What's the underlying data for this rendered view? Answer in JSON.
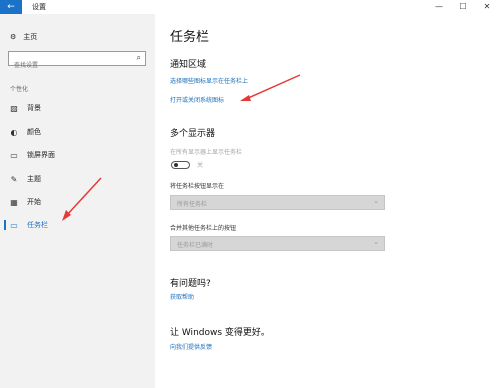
{
  "window": {
    "title": "设置",
    "back_icon": "←",
    "minimize_icon": "—",
    "maximize_icon": "☐",
    "close_icon": "✕"
  },
  "sidebar": {
    "home_icon": "⚙",
    "home_label": "主页",
    "search_placeholder": "查找设置",
    "search_icon": "⌕",
    "section_label": "个性化",
    "items": [
      {
        "label": "背景",
        "icon": "▨"
      },
      {
        "label": "颜色",
        "icon": "◐"
      },
      {
        "label": "锁屏界面",
        "icon": "▭"
      },
      {
        "label": "主题",
        "icon": "✎"
      },
      {
        "label": "开始",
        "icon": "▦"
      },
      {
        "label": "任务栏",
        "icon": "▭"
      }
    ],
    "active_item": "任务栏"
  },
  "main": {
    "title": "任务栏",
    "notification": {
      "title": "通知区域",
      "link1": "选择哪些图标显示在任务栏上",
      "link2": "打开或关闭系统图标"
    },
    "multi_display": {
      "title": "多个显示器",
      "show_all_label": "在所有显示器上显示任务栏",
      "toggle_state": "关",
      "buttons_label": "将任务栏按钮显示在",
      "buttons_value": "所有任务栏",
      "combine_label": "合并其他任务栏上的按钮",
      "combine_value": "任务栏已满时"
    },
    "questions": {
      "title": "有问题吗?",
      "link": "获取帮助"
    },
    "feedback": {
      "title": "让 Windows 变得更好。",
      "link": "向我们提供反馈"
    }
  },
  "colors": {
    "accent": "#1a73c9",
    "arrow": "#e53935"
  }
}
